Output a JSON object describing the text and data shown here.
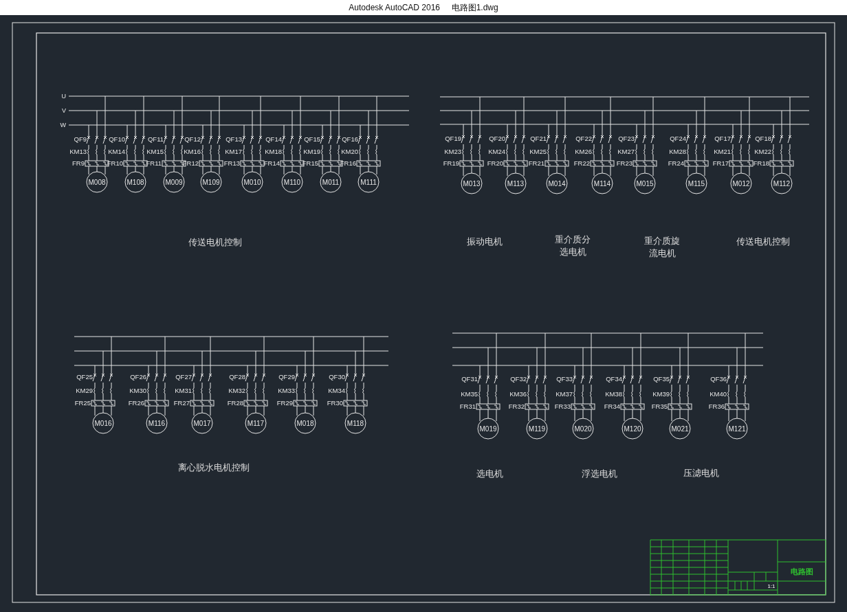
{
  "window": {
    "title": "Autodesk AutoCAD 2016     电路图1.dwg"
  },
  "drawing": {
    "groups": [
      {
        "phases": [
          "U",
          "V",
          "W"
        ],
        "circuits": [
          {
            "qf": "QF9",
            "km": "KM13",
            "fr": "FR9",
            "motor": "M008"
          },
          {
            "qf": "QF10",
            "km": "KM14",
            "fr": "FR10",
            "motor": "M108"
          },
          {
            "qf": "QF11",
            "km": "KM15",
            "fr": "FR11",
            "motor": "M009"
          },
          {
            "qf": "QF12",
            "km": "KM16",
            "fr": "FR12",
            "motor": "M109"
          },
          {
            "qf": "QF13",
            "km": "KM17",
            "fr": "FR13",
            "motor": "M010"
          },
          {
            "qf": "QF14",
            "km": "KM18",
            "fr": "FR14",
            "motor": "M110"
          },
          {
            "qf": "QF15",
            "km": "KM19",
            "fr": "FR15",
            "motor": "M011"
          },
          {
            "qf": "QF16",
            "km": "KM20",
            "fr": "FR16",
            "motor": "M111"
          }
        ]
      },
      {
        "circuits": [
          {
            "qf": "QF19",
            "km": "KM23",
            "fr": "FR19",
            "motor": "M013"
          },
          {
            "qf": "QF20",
            "km": "KM24",
            "fr": "FR20",
            "motor": "M113"
          },
          {
            "qf": "QF21",
            "km": "KM25",
            "fr": "FR21",
            "motor": "M014"
          },
          {
            "qf": "QF22",
            "km": "KM26",
            "fr": "FR22",
            "motor": "M114"
          },
          {
            "qf": "QF23",
            "km": "KM27",
            "fr": "FR23",
            "motor": "M015"
          },
          {
            "qf": "QF24",
            "km": "KM28",
            "fr": "FR24",
            "motor": "M115"
          },
          {
            "qf": "QF17",
            "km": "KM21",
            "fr": "FR17",
            "motor": "M012"
          },
          {
            "qf": "QF18",
            "km": "KM22",
            "fr": "FR18",
            "motor": "M112"
          }
        ]
      },
      {
        "circuits": [
          {
            "qf": "QF25",
            "km": "KM29",
            "fr": "FR25",
            "motor": "M016"
          },
          {
            "qf": "QF26",
            "km": "KM30",
            "fr": "FR26",
            "motor": "M116"
          },
          {
            "qf": "QF27",
            "km": "KM31",
            "fr": "FR27",
            "motor": "M017"
          },
          {
            "qf": "QF28",
            "km": "KM32",
            "fr": "FR28",
            "motor": "M117"
          },
          {
            "qf": "QF29",
            "km": "KM33",
            "fr": "FR29",
            "motor": "M018"
          },
          {
            "qf": "QF30",
            "km": "KM34",
            "fr": "FR30",
            "motor": "M118"
          }
        ]
      },
      {
        "circuits": [
          {
            "qf": "QF31",
            "km": "KM35",
            "fr": "FR31",
            "motor": "M019"
          },
          {
            "qf": "QF32",
            "km": "KM36",
            "fr": "FR32",
            "motor": "M119"
          },
          {
            "qf": "QF33",
            "km": "KM37",
            "fr": "FR33",
            "motor": "M020"
          },
          {
            "qf": "QF34",
            "km": "KM38",
            "fr": "FR34",
            "motor": "M120"
          },
          {
            "qf": "QF35",
            "km": "KM39",
            "fr": "FR35",
            "motor": "M021"
          },
          {
            "qf": "QF36",
            "km": "KM40",
            "fr": "FR36",
            "motor": "M121"
          }
        ]
      }
    ],
    "captions": [
      {
        "lines": [
          "传送电机控制"
        ]
      },
      {
        "lines": [
          "振动电机"
        ]
      },
      {
        "lines": [
          "重介质分",
          "选电机"
        ]
      },
      {
        "lines": [
          "重介质旋",
          "流电机"
        ]
      },
      {
        "lines": [
          "传送电机控制"
        ]
      },
      {
        "lines": [
          "离心脱水电机控制"
        ]
      },
      {
        "lines": [
          "选电机"
        ]
      },
      {
        "lines": [
          "浮选电机"
        ]
      },
      {
        "lines": [
          "压滤电机"
        ]
      }
    ],
    "title_block": {
      "drawing_name": "电路图",
      "scale": "1:1"
    }
  }
}
